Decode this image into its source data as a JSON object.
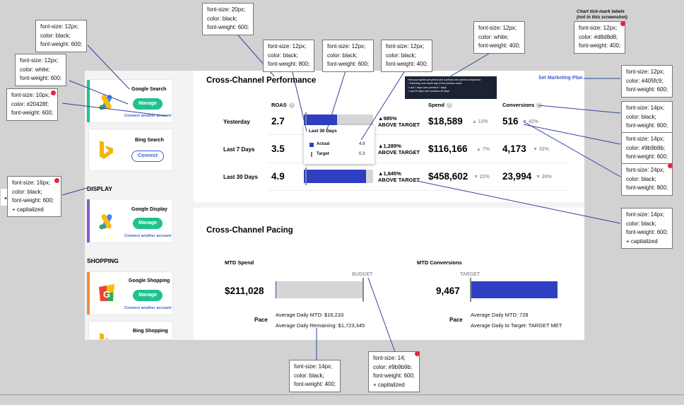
{
  "annotations": {
    "n1": [
      "font-size: 12px;",
      "color: black;",
      "font-weight: 600;"
    ],
    "n2": [
      "font-size: 12px;",
      "color: white;",
      "font-weight: 600;"
    ],
    "n3": [
      "font-size: 10px;",
      "color: #20428f;",
      "font-weight: 600;"
    ],
    "n4": [
      "font-size: 16px;",
      "color: black;",
      "font-weight: 600;",
      "+ capitalized"
    ],
    "n5": [
      "font-size: 20px;",
      "color: black;",
      "font-weight: 600;"
    ],
    "n6": [
      "font-size: 12px;",
      "color: black;",
      "font-weight: 800;"
    ],
    "n7": [
      "font-size: 12px;",
      "color: black;",
      "font-weight: 600;"
    ],
    "n8": [
      "font-size: 12px;",
      "color: black;",
      "font-weight: 400;"
    ],
    "n9": [
      "font-size: 12px;",
      "color: white;",
      "font-weight: 400;"
    ],
    "n10_title": [
      "Chart tick-mark labels",
      "(not in this screenshot)"
    ],
    "n10": [
      "font-size: 12px;",
      "color: #d8d8d8;",
      "font-weight: 400;"
    ],
    "n11": [
      "font-size: 12px;",
      "color: #405fc9;",
      "font-weight: 600;"
    ],
    "n12": [
      "font-size: 14px;",
      "color: black;",
      "font-weight: 600;"
    ],
    "n13": [
      "font-size: 14px;",
      "color: #9b9b9b;",
      "font-weight: 600;"
    ],
    "n14": [
      "font-size: 24px;",
      "color: black;",
      "font-weight: 800;"
    ],
    "n15": [
      "font-size: 14px;",
      "color: black;",
      "font-weight: 600;",
      "+ capitalized"
    ],
    "n16": [
      "font-size: 14px;",
      "color: black;",
      "font-weight: 400;"
    ],
    "n17": [
      "font-size: 14;",
      "color: #9b9b9b;",
      "font-weight: 600;",
      "+ capitalized"
    ]
  },
  "sidebar": {
    "search_cards": [
      {
        "title": "Google Search",
        "button": "Manage",
        "link": "Connect another account"
      },
      {
        "title": "Bing Search",
        "button": "Connect"
      }
    ],
    "display_heading": "DISPLAY",
    "display_card": {
      "title": "Google Display",
      "button": "Manage",
      "link": "Connect another account"
    },
    "shopping_heading": "SHOPPING",
    "shopping_cards": [
      {
        "title": "Google Shopping",
        "button": "Manage",
        "link": "Connect another account"
      },
      {
        "title": "Bing Shopping"
      }
    ]
  },
  "performance": {
    "title": "Cross-Channel Performance",
    "link": "Set Marketing Plan",
    "cols": {
      "roas": "ROAS",
      "spend": "Spend",
      "conversions": "Conversions"
    },
    "tooltip_dark": [
      "How your spend per period and a period-over-period comparison:",
      "• Yesterday over same day of the previous week",
      "• Last 7 days over previous 7 days",
      "• Last 30 days over previous 30 days"
    ],
    "popup": {
      "title": "Last 30 Days",
      "actual_label": "Actual",
      "actual_value": "4.9",
      "target_label": "Target",
      "target_value": "0.3"
    },
    "rows": [
      {
        "label": "Yesterday",
        "roas": "2.7",
        "roas_fill": 0.48,
        "pct": "985%",
        "above": "ABOVE TARGET",
        "spend": "$18,589",
        "spend_delta": "13%",
        "conv": "516",
        "conv_delta": "42%"
      },
      {
        "label": "Last 7 Days",
        "roas": "3.5",
        "roas_fill": 0.62,
        "pct": "1,289%",
        "above": "ABOVE TARGET",
        "spend": "$116,166",
        "spend_delta": "7%",
        "conv": "4,173",
        "conv_delta": "32%"
      },
      {
        "label": "Last 30 Days",
        "roas": "4.9",
        "roas_fill": 0.9,
        "pct": "1,845%",
        "above": "ABOVE TARGET",
        "spend": "$458,602",
        "spend_delta": "22%",
        "conv": "23,994",
        "conv_delta": "26%"
      }
    ]
  },
  "pacing": {
    "title": "Cross-Channel Pacing",
    "spend": {
      "label": "MTD Spend",
      "value": "$211,028",
      "marker": "BUDGET",
      "fill": 0.01,
      "pace_label": "Pace",
      "line1": "Average Daily MTD: $16,233",
      "line2": "Average Daily Remaining: $1,723,345"
    },
    "conversions": {
      "label": "MTD Conversions",
      "value": "9,467",
      "marker": "TARGET",
      "fill": 1.0,
      "pace_label": "Pace",
      "line1": "Average Daily MTD: 728",
      "line2": "Average Daily to Target: TARGET MET"
    }
  },
  "colors": {
    "green": "#20c28f",
    "blue_link": "#405fc9",
    "bar_blue": "#2f3fc4",
    "red_dot": "#e8263f"
  }
}
